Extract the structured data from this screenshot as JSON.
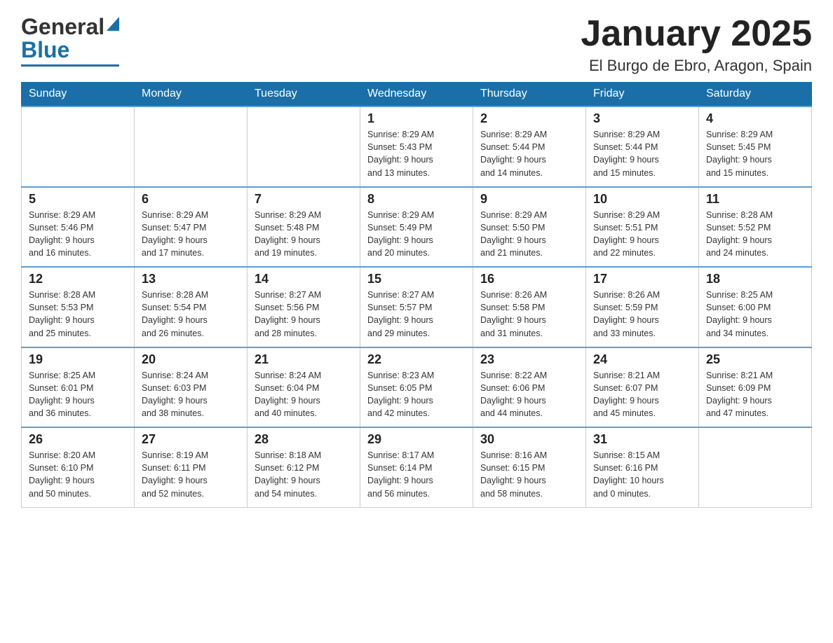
{
  "header": {
    "logo_line1": "General",
    "logo_line2": "Blue",
    "title": "January 2025",
    "subtitle": "El Burgo de Ebro, Aragon, Spain"
  },
  "days_of_week": [
    "Sunday",
    "Monday",
    "Tuesday",
    "Wednesday",
    "Thursday",
    "Friday",
    "Saturday"
  ],
  "weeks": [
    [
      {
        "day": "",
        "info": ""
      },
      {
        "day": "",
        "info": ""
      },
      {
        "day": "",
        "info": ""
      },
      {
        "day": "1",
        "info": "Sunrise: 8:29 AM\nSunset: 5:43 PM\nDaylight: 9 hours\nand 13 minutes."
      },
      {
        "day": "2",
        "info": "Sunrise: 8:29 AM\nSunset: 5:44 PM\nDaylight: 9 hours\nand 14 minutes."
      },
      {
        "day": "3",
        "info": "Sunrise: 8:29 AM\nSunset: 5:44 PM\nDaylight: 9 hours\nand 15 minutes."
      },
      {
        "day": "4",
        "info": "Sunrise: 8:29 AM\nSunset: 5:45 PM\nDaylight: 9 hours\nand 15 minutes."
      }
    ],
    [
      {
        "day": "5",
        "info": "Sunrise: 8:29 AM\nSunset: 5:46 PM\nDaylight: 9 hours\nand 16 minutes."
      },
      {
        "day": "6",
        "info": "Sunrise: 8:29 AM\nSunset: 5:47 PM\nDaylight: 9 hours\nand 17 minutes."
      },
      {
        "day": "7",
        "info": "Sunrise: 8:29 AM\nSunset: 5:48 PM\nDaylight: 9 hours\nand 19 minutes."
      },
      {
        "day": "8",
        "info": "Sunrise: 8:29 AM\nSunset: 5:49 PM\nDaylight: 9 hours\nand 20 minutes."
      },
      {
        "day": "9",
        "info": "Sunrise: 8:29 AM\nSunset: 5:50 PM\nDaylight: 9 hours\nand 21 minutes."
      },
      {
        "day": "10",
        "info": "Sunrise: 8:29 AM\nSunset: 5:51 PM\nDaylight: 9 hours\nand 22 minutes."
      },
      {
        "day": "11",
        "info": "Sunrise: 8:28 AM\nSunset: 5:52 PM\nDaylight: 9 hours\nand 24 minutes."
      }
    ],
    [
      {
        "day": "12",
        "info": "Sunrise: 8:28 AM\nSunset: 5:53 PM\nDaylight: 9 hours\nand 25 minutes."
      },
      {
        "day": "13",
        "info": "Sunrise: 8:28 AM\nSunset: 5:54 PM\nDaylight: 9 hours\nand 26 minutes."
      },
      {
        "day": "14",
        "info": "Sunrise: 8:27 AM\nSunset: 5:56 PM\nDaylight: 9 hours\nand 28 minutes."
      },
      {
        "day": "15",
        "info": "Sunrise: 8:27 AM\nSunset: 5:57 PM\nDaylight: 9 hours\nand 29 minutes."
      },
      {
        "day": "16",
        "info": "Sunrise: 8:26 AM\nSunset: 5:58 PM\nDaylight: 9 hours\nand 31 minutes."
      },
      {
        "day": "17",
        "info": "Sunrise: 8:26 AM\nSunset: 5:59 PM\nDaylight: 9 hours\nand 33 minutes."
      },
      {
        "day": "18",
        "info": "Sunrise: 8:25 AM\nSunset: 6:00 PM\nDaylight: 9 hours\nand 34 minutes."
      }
    ],
    [
      {
        "day": "19",
        "info": "Sunrise: 8:25 AM\nSunset: 6:01 PM\nDaylight: 9 hours\nand 36 minutes."
      },
      {
        "day": "20",
        "info": "Sunrise: 8:24 AM\nSunset: 6:03 PM\nDaylight: 9 hours\nand 38 minutes."
      },
      {
        "day": "21",
        "info": "Sunrise: 8:24 AM\nSunset: 6:04 PM\nDaylight: 9 hours\nand 40 minutes."
      },
      {
        "day": "22",
        "info": "Sunrise: 8:23 AM\nSunset: 6:05 PM\nDaylight: 9 hours\nand 42 minutes."
      },
      {
        "day": "23",
        "info": "Sunrise: 8:22 AM\nSunset: 6:06 PM\nDaylight: 9 hours\nand 44 minutes."
      },
      {
        "day": "24",
        "info": "Sunrise: 8:21 AM\nSunset: 6:07 PM\nDaylight: 9 hours\nand 45 minutes."
      },
      {
        "day": "25",
        "info": "Sunrise: 8:21 AM\nSunset: 6:09 PM\nDaylight: 9 hours\nand 47 minutes."
      }
    ],
    [
      {
        "day": "26",
        "info": "Sunrise: 8:20 AM\nSunset: 6:10 PM\nDaylight: 9 hours\nand 50 minutes."
      },
      {
        "day": "27",
        "info": "Sunrise: 8:19 AM\nSunset: 6:11 PM\nDaylight: 9 hours\nand 52 minutes."
      },
      {
        "day": "28",
        "info": "Sunrise: 8:18 AM\nSunset: 6:12 PM\nDaylight: 9 hours\nand 54 minutes."
      },
      {
        "day": "29",
        "info": "Sunrise: 8:17 AM\nSunset: 6:14 PM\nDaylight: 9 hours\nand 56 minutes."
      },
      {
        "day": "30",
        "info": "Sunrise: 8:16 AM\nSunset: 6:15 PM\nDaylight: 9 hours\nand 58 minutes."
      },
      {
        "day": "31",
        "info": "Sunrise: 8:15 AM\nSunset: 6:16 PM\nDaylight: 10 hours\nand 0 minutes."
      },
      {
        "day": "",
        "info": ""
      }
    ]
  ]
}
